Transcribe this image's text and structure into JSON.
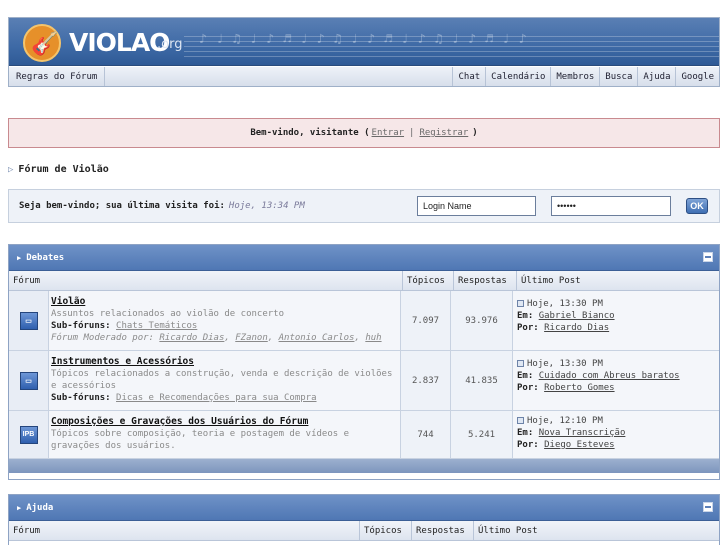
{
  "header": {
    "logo_text": "VIOLAO",
    "logo_suffix": ".org",
    "nav": {
      "rules": "Regras do Fórum",
      "items": [
        "Chat",
        "Calendário",
        "Membros",
        "Busca",
        "Ajuda",
        "Google"
      ]
    }
  },
  "welcome": {
    "text": "Bem-vindo, visitante (",
    "login_link": "Entrar",
    "separator": "|",
    "register_link": "Registrar",
    "close": ")"
  },
  "breadcrumb": {
    "title": "Fórum de Violão"
  },
  "loginbar": {
    "message": "Seja bem-vindo; sua última visita foi:",
    "last_visit": "Hoje, 13:34 PM",
    "login_value": "Login Name",
    "password_value": "••••••",
    "ok_label": "OK"
  },
  "categories": [
    {
      "title": "Debates",
      "columns": {
        "forum": "Fórum",
        "topics": "Tópicos",
        "replies": "Respostas",
        "last": "Último Post"
      },
      "forums": [
        {
          "icon": "",
          "name": "Violão",
          "description": "Assuntos relacionados ao violão de concerto",
          "subforums_label": "Sub-fóruns:",
          "subforums": "Chats Temáticos",
          "moderators_label": "Fórum Moderado por:",
          "moderators": [
            "Ricardo Dias",
            "FZanon",
            "Antonio Carlos",
            "huh"
          ],
          "topics": "7.097",
          "replies": "93.976",
          "last_date": "Hoje, 13:30 PM",
          "last_in_label": "Em:",
          "last_in": "Gabriel Bianco",
          "last_by_label": "Por:",
          "last_by": "Ricardo Dias"
        },
        {
          "icon": "",
          "name": "Instrumentos e Acessórios",
          "description": "Tópicos relacionados a construção, venda e descrição de violões e acessórios",
          "subforums_label": "Sub-fóruns:",
          "subforums": "Dicas e Recomendações para sua Compra",
          "topics": "2.837",
          "replies": "41.835",
          "last_date": "Hoje, 13:30 PM",
          "last_in_label": "Em:",
          "last_in": "Cuidado com Abreus baratos",
          "last_by_label": "Por:",
          "last_by": "Roberto Gomes"
        },
        {
          "icon": "IPB",
          "name": "Composições e Gravações dos Usuários do Fórum",
          "description": "Tópicos sobre composição, teoria e postagem de vídeos e gravações dos usuários.",
          "topics": "744",
          "replies": "5.241",
          "last_date": "Hoje, 12:10 PM",
          "last_in_label": "Em:",
          "last_in": "Nova Transcrição",
          "last_by_label": "Por:",
          "last_by": "Diego Esteves"
        }
      ]
    },
    {
      "title": "Ajuda",
      "columns": {
        "forum": "Fórum",
        "topics": "Tópicos",
        "replies": "Respostas",
        "last": "Último Post"
      }
    }
  ],
  "colors": {
    "header_blue": "#4f77b4",
    "welcome_bg": "#f6e7e8",
    "link": "#3a4f7a"
  }
}
